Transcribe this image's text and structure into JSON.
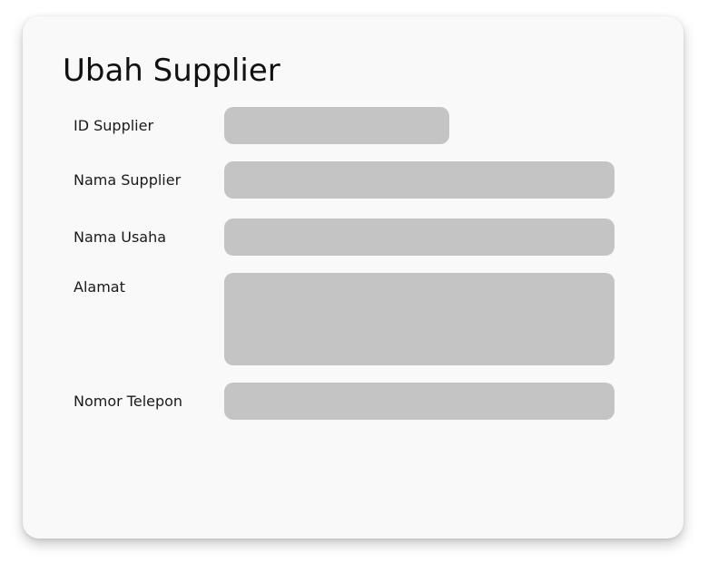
{
  "form": {
    "title": "Ubah Supplier",
    "fields": [
      {
        "label": "ID Supplier",
        "value": "",
        "placeholder": ""
      },
      {
        "label": "Nama Supplier",
        "value": "",
        "placeholder": ""
      },
      {
        "label": "Nama Usaha",
        "value": "",
        "placeholder": ""
      },
      {
        "label": "Alamat",
        "value": "",
        "placeholder": ""
      },
      {
        "label": "Nomor Telepon",
        "value": "",
        "placeholder": ""
      }
    ]
  },
  "colors": {
    "card_background": "#f9f9f9",
    "field_background": "#c4c4c4",
    "text": "#111111"
  }
}
